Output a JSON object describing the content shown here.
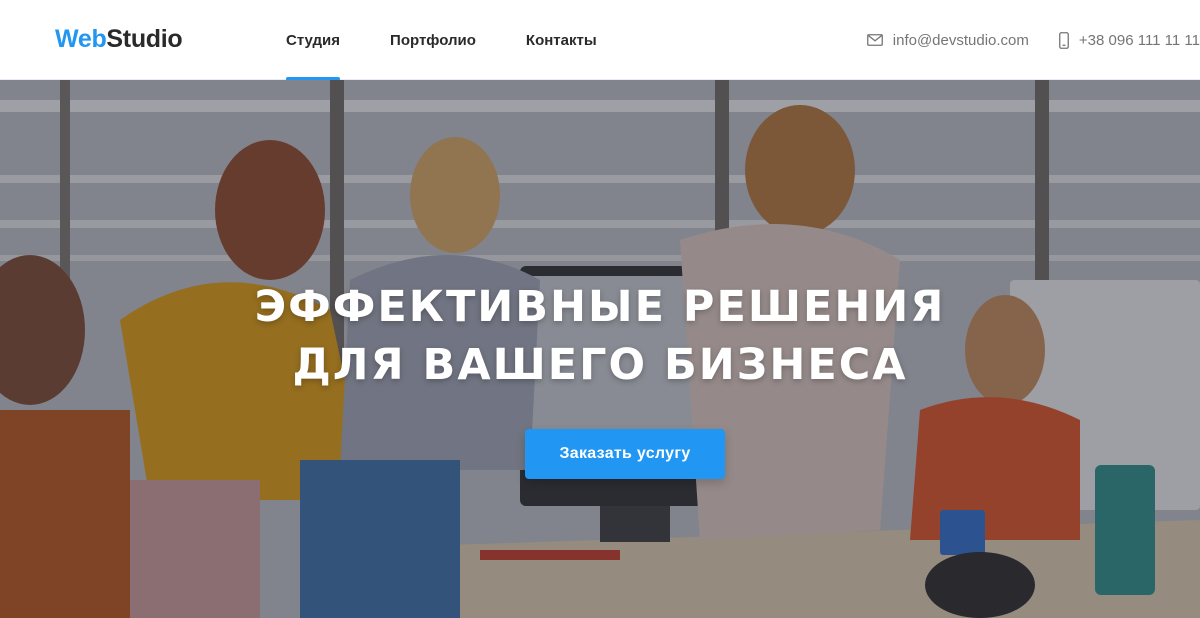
{
  "header": {
    "logo": {
      "part1": "Web",
      "part2": "Studio"
    },
    "nav": [
      {
        "label": "Студия",
        "active": true
      },
      {
        "label": "Портфолио",
        "active": false
      },
      {
        "label": "Контакты",
        "active": false
      }
    ],
    "contacts": {
      "email": "info@devstudio.com",
      "phone": "+38 096 111 11 11",
      "email_icon": "envelope-icon",
      "phone_icon": "smartphone-icon"
    }
  },
  "hero": {
    "title_line1": "Эффективные решения",
    "title_line2": "для вашего бизнеса",
    "button_label": "Заказать услугу",
    "background_image": "team-working-in-office-photo"
  },
  "colors": {
    "accent": "#2196f3",
    "text_dark": "#2a2a2a",
    "text_muted": "#757575",
    "hero_text": "#ffffff"
  }
}
